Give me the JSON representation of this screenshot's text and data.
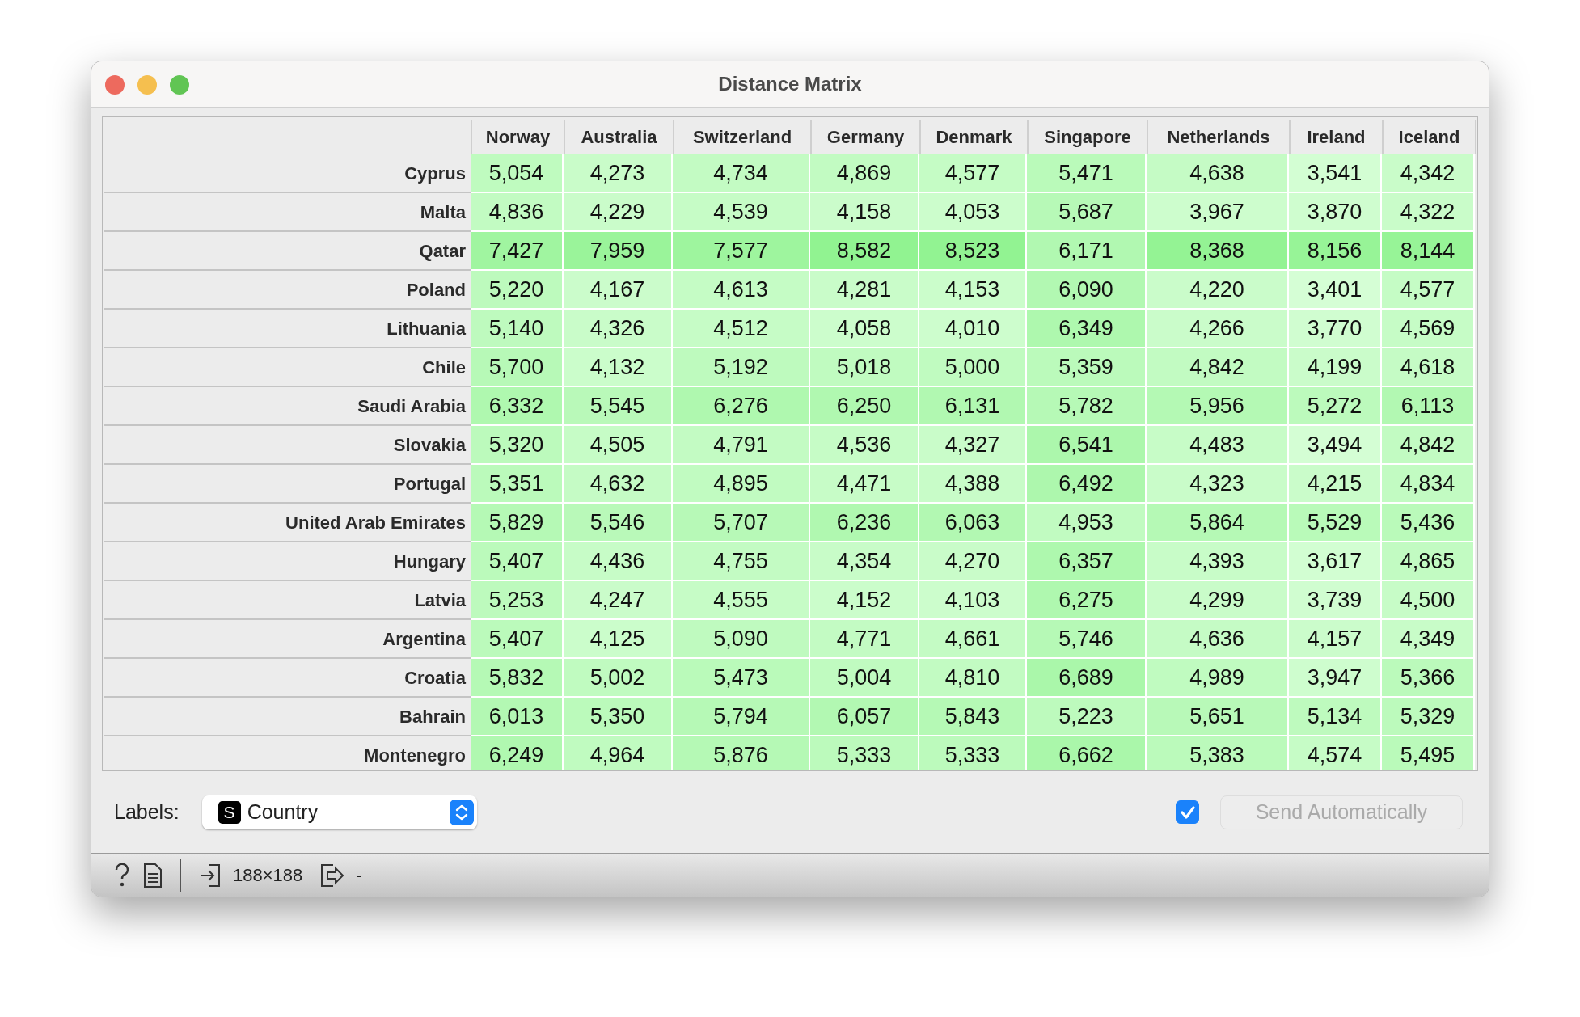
{
  "window": {
    "title": "Distance Matrix"
  },
  "matrix": {
    "columns": [
      "Norway",
      "Australia",
      "Switzerland",
      "Germany",
      "Denmark",
      "Singapore",
      "Netherlands",
      "Ireland",
      "Iceland"
    ],
    "rows": [
      {
        "label": "Cyprus",
        "values": [
          "5,054",
          "4,273",
          "4,734",
          "4,869",
          "4,577",
          "5,471",
          "4,638",
          "3,541",
          "4,342"
        ]
      },
      {
        "label": "Malta",
        "values": [
          "4,836",
          "4,229",
          "4,539",
          "4,158",
          "4,053",
          "5,687",
          "3,967",
          "3,870",
          "4,322"
        ]
      },
      {
        "label": "Qatar",
        "values": [
          "7,427",
          "7,959",
          "7,577",
          "8,582",
          "8,523",
          "6,171",
          "8,368",
          "8,156",
          "8,144"
        ]
      },
      {
        "label": "Poland",
        "values": [
          "5,220",
          "4,167",
          "4,613",
          "4,281",
          "4,153",
          "6,090",
          "4,220",
          "3,401",
          "4,577"
        ]
      },
      {
        "label": "Lithuania",
        "values": [
          "5,140",
          "4,326",
          "4,512",
          "4,058",
          "4,010",
          "6,349",
          "4,266",
          "3,770",
          "4,569"
        ]
      },
      {
        "label": "Chile",
        "values": [
          "5,700",
          "4,132",
          "5,192",
          "5,018",
          "5,000",
          "5,359",
          "4,842",
          "4,199",
          "4,618"
        ]
      },
      {
        "label": "Saudi Arabia",
        "values": [
          "6,332",
          "5,545",
          "6,276",
          "6,250",
          "6,131",
          "5,782",
          "5,956",
          "5,272",
          "6,113"
        ]
      },
      {
        "label": "Slovakia",
        "values": [
          "5,320",
          "4,505",
          "4,791",
          "4,536",
          "4,327",
          "6,541",
          "4,483",
          "3,494",
          "4,842"
        ]
      },
      {
        "label": "Portugal",
        "values": [
          "5,351",
          "4,632",
          "4,895",
          "4,471",
          "4,388",
          "6,492",
          "4,323",
          "4,215",
          "4,834"
        ]
      },
      {
        "label": "United Arab Emirates",
        "values": [
          "5,829",
          "5,546",
          "5,707",
          "6,236",
          "6,063",
          "4,953",
          "5,864",
          "5,529",
          "5,436"
        ]
      },
      {
        "label": "Hungary",
        "values": [
          "5,407",
          "4,436",
          "4,755",
          "4,354",
          "4,270",
          "6,357",
          "4,393",
          "3,617",
          "4,865"
        ]
      },
      {
        "label": "Latvia",
        "values": [
          "5,253",
          "4,247",
          "4,555",
          "4,152",
          "4,103",
          "6,275",
          "4,299",
          "3,739",
          "4,500"
        ]
      },
      {
        "label": "Argentina",
        "values": [
          "5,407",
          "4,125",
          "5,090",
          "4,771",
          "4,661",
          "5,746",
          "4,636",
          "4,157",
          "4,349"
        ]
      },
      {
        "label": "Croatia",
        "values": [
          "5,832",
          "5,002",
          "5,473",
          "5,004",
          "4,810",
          "6,689",
          "4,989",
          "3,947",
          "5,366"
        ]
      },
      {
        "label": "Bahrain",
        "values": [
          "6,013",
          "5,350",
          "5,794",
          "6,057",
          "5,843",
          "5,223",
          "5,651",
          "5,134",
          "5,329"
        ]
      },
      {
        "label": "Montenegro",
        "values": [
          "6,249",
          "4,964",
          "5,876",
          "5,333",
          "5,333",
          "6,662",
          "5,383",
          "4,574",
          "5,495"
        ]
      }
    ]
  },
  "controls": {
    "labels_caption": "Labels:",
    "labels_select": {
      "value": "Country",
      "type_badge": "S"
    },
    "send_automatically": {
      "checked": true,
      "label": "Send Automatically",
      "disabled": true
    }
  },
  "status_bar": {
    "input_count": "188×188",
    "output_count": "-"
  }
}
